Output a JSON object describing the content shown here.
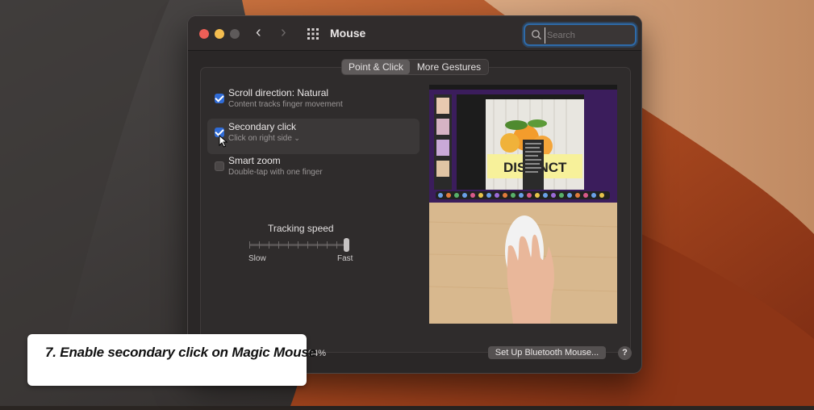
{
  "window": {
    "title": "Mouse"
  },
  "search": {
    "placeholder": "Search"
  },
  "tabs": [
    {
      "label": "Point & Click",
      "selected": true
    },
    {
      "label": "More Gestures",
      "selected": false
    }
  ],
  "options": [
    {
      "title": "Scroll direction: Natural",
      "subtitle": "Content tracks finger movement",
      "checked": true
    },
    {
      "title": "Secondary click",
      "subtitle": "Click on right side",
      "checked": true
    },
    {
      "title": "Smart zoom",
      "subtitle": "Double-tap with one finger",
      "checked": false
    }
  ],
  "tracking": {
    "title": "Tracking speed",
    "slow_label": "Slow",
    "fast_label": "Fast",
    "value_fraction": 1.0
  },
  "footer": {
    "battery": "94%",
    "bluetooth_button": "Set Up Bluetooth Mouse...",
    "help_button": "?"
  },
  "caption": {
    "text": "7. Enable secondary click on Magic Mouse"
  },
  "preview_text": {
    "headline": "DISTINCT"
  },
  "colors": {
    "accent": "#2f6bd6",
    "search_focus": "#2e6aa8",
    "window_bg": "#2a2727"
  }
}
